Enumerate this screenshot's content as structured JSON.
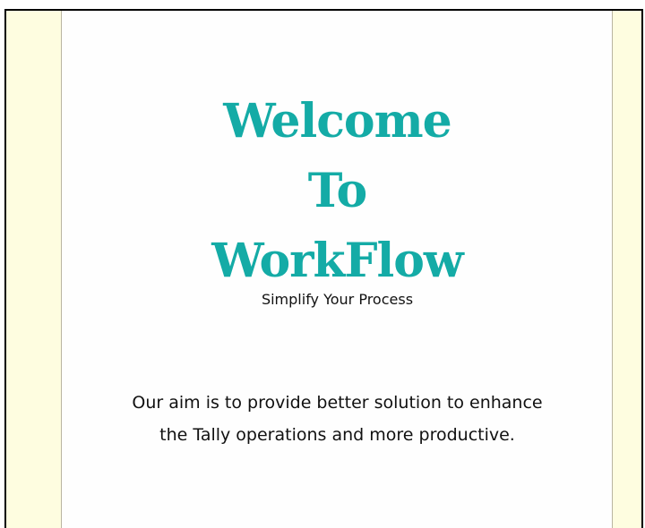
{
  "hero": {
    "line1": "Welcome",
    "line2": "To",
    "line3": "WorkFlow",
    "tagline": "Simplify Your Process"
  },
  "aim": {
    "line1": "Our aim is to provide better solution to enhance",
    "line2": "the Tally operations and more productive."
  },
  "colors": {
    "title": "#14aba6",
    "side_panel": "#fefde0",
    "main_bg": "#fefefe",
    "text": "#111111"
  }
}
